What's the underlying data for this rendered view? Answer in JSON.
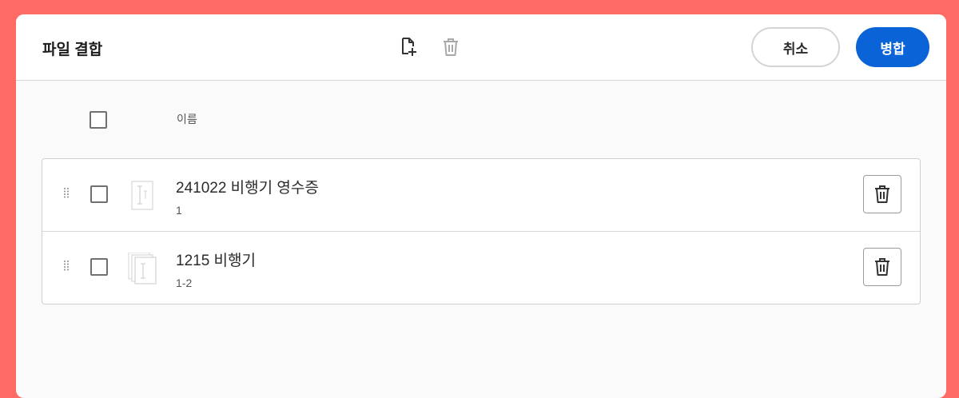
{
  "dialog": {
    "title": "파일 결합",
    "toolbar": {
      "add_file_icon": "file-add-icon",
      "delete_icon": "trash-icon"
    },
    "cancel_label": "취소",
    "merge_label": "병합"
  },
  "list": {
    "column_name": "이름",
    "files": [
      {
        "name": "241022 비행기 영수증",
        "pages": "1"
      },
      {
        "name": "1215 비행기",
        "pages": "1-2"
      }
    ]
  },
  "colors": {
    "background": "#ff6a64",
    "accent": "#0a64d8"
  }
}
